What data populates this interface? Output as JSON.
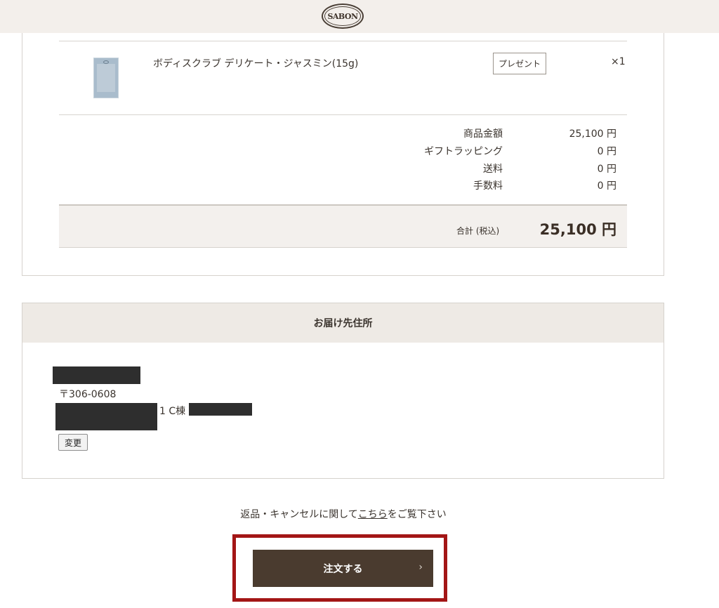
{
  "header": {
    "logo_text": "SABON"
  },
  "product": {
    "name": "ボディスクラブ デリケート・ジャスミン(15g)",
    "tag": "プレゼント",
    "quantity": "×1"
  },
  "summary": {
    "rows": [
      {
        "label": "商品金額",
        "value": "25,100 円"
      },
      {
        "label": "ギフトラッピング",
        "value": "0 円"
      },
      {
        "label": "送料",
        "value": "0 円"
      },
      {
        "label": "手数料",
        "value": "0 円"
      }
    ],
    "total_label": "合計 (税込)",
    "total_value": "25,100 円"
  },
  "address": {
    "heading": "お届け先住所",
    "zip": "〒306-0608",
    "line_fragment": "1 C棟",
    "change_label": "変更"
  },
  "notice": {
    "prefix": "返品・キャンセルに関して",
    "link": "こちら",
    "suffix": "をご覧下さい"
  },
  "submit": {
    "label": "注文する",
    "chevron": "›"
  },
  "colors": {
    "brand_dark": "#4a3b2f",
    "highlight": "#a31616",
    "header_bg": "#f3efeb"
  }
}
